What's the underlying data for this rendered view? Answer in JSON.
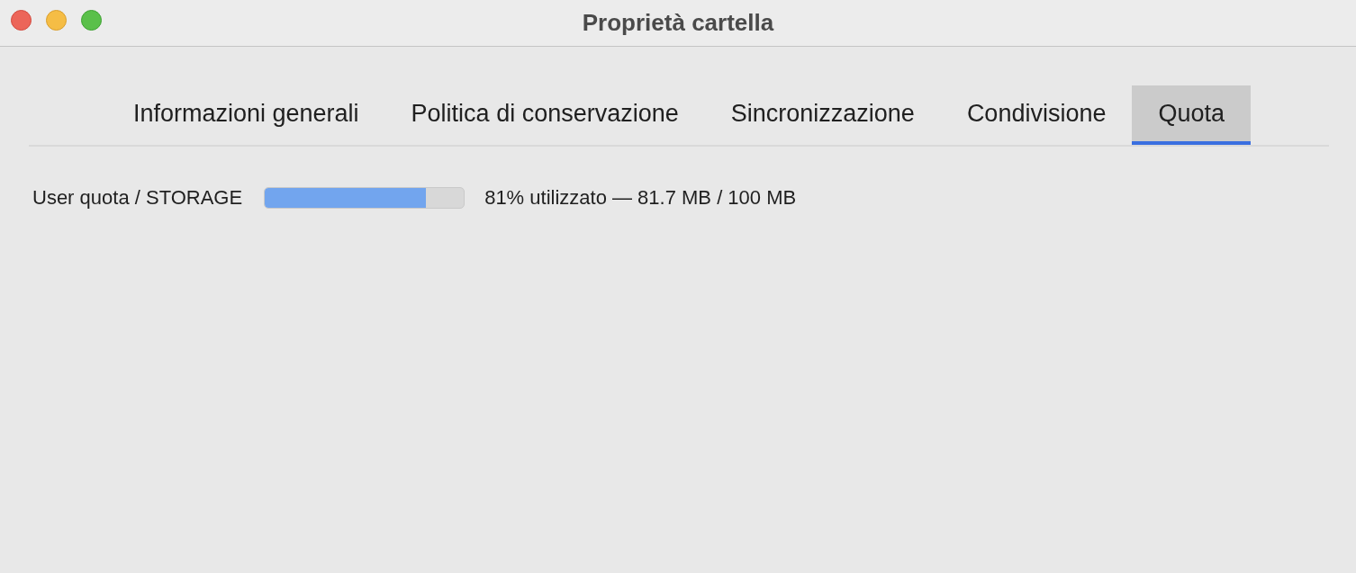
{
  "window": {
    "title": "Proprietà cartella"
  },
  "tabs": [
    {
      "label": "Informazioni generali",
      "selected": false
    },
    {
      "label": "Politica di conservazione",
      "selected": false
    },
    {
      "label": "Sincronizzazione",
      "selected": false
    },
    {
      "label": "Condivisione",
      "selected": false
    },
    {
      "label": "Quota",
      "selected": true
    }
  ],
  "quota": {
    "label": "User quota / STORAGE",
    "level": 0.81,
    "reading": "81% utilizzato — 81.7 MB / 100 MB"
  }
}
